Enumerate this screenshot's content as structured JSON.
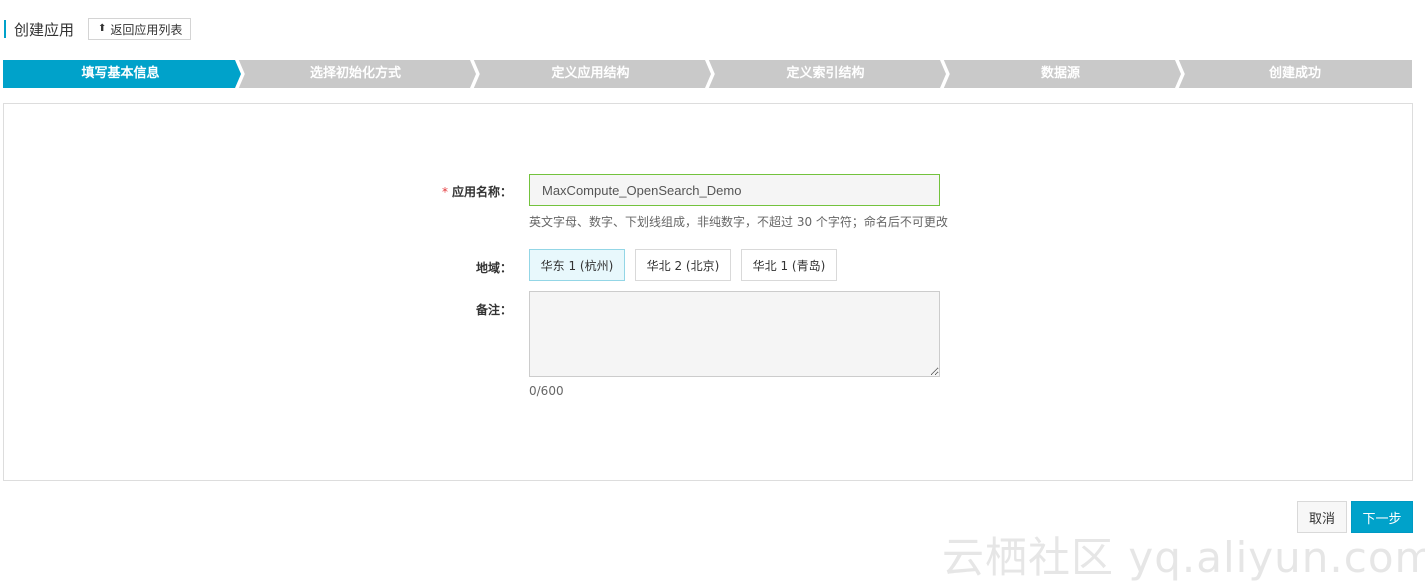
{
  "header": {
    "title": "创建应用",
    "back_button": {
      "icon": "upload-arrow-icon",
      "label": "返回应用列表"
    }
  },
  "steps": [
    {
      "label": "填写基本信息",
      "active": true
    },
    {
      "label": "选择初始化方式",
      "active": false
    },
    {
      "label": "定义应用结构",
      "active": false
    },
    {
      "label": "定义索引结构",
      "active": false
    },
    {
      "label": "数据源",
      "active": false
    },
    {
      "label": "创建成功",
      "active": false
    }
  ],
  "colors": {
    "active_step": "#00a2ca",
    "inactive_step": "#c9c9c9",
    "input_border": "#73c23d",
    "primary_button": "#00a2ca"
  },
  "form": {
    "name": {
      "required_mark": "*",
      "label": "应用名称：",
      "value": "MaxCompute_OpenSearch_Demo",
      "hint": "英文字母、数字、下划线组成，非纯数字，不超过 30 个字符；命名后不可更改"
    },
    "region": {
      "label": "地域：",
      "options": [
        "华东 1 (杭州)",
        "华北 2 (北京)",
        "华北 1 (青岛)"
      ],
      "selected": "华东 1 (杭州)"
    },
    "notes": {
      "label": "备注：",
      "value": "",
      "counter": "0/600"
    }
  },
  "actions": {
    "cancel": "取消",
    "next": "下一步"
  },
  "watermark": "云栖社区 yq.aliyun.com"
}
